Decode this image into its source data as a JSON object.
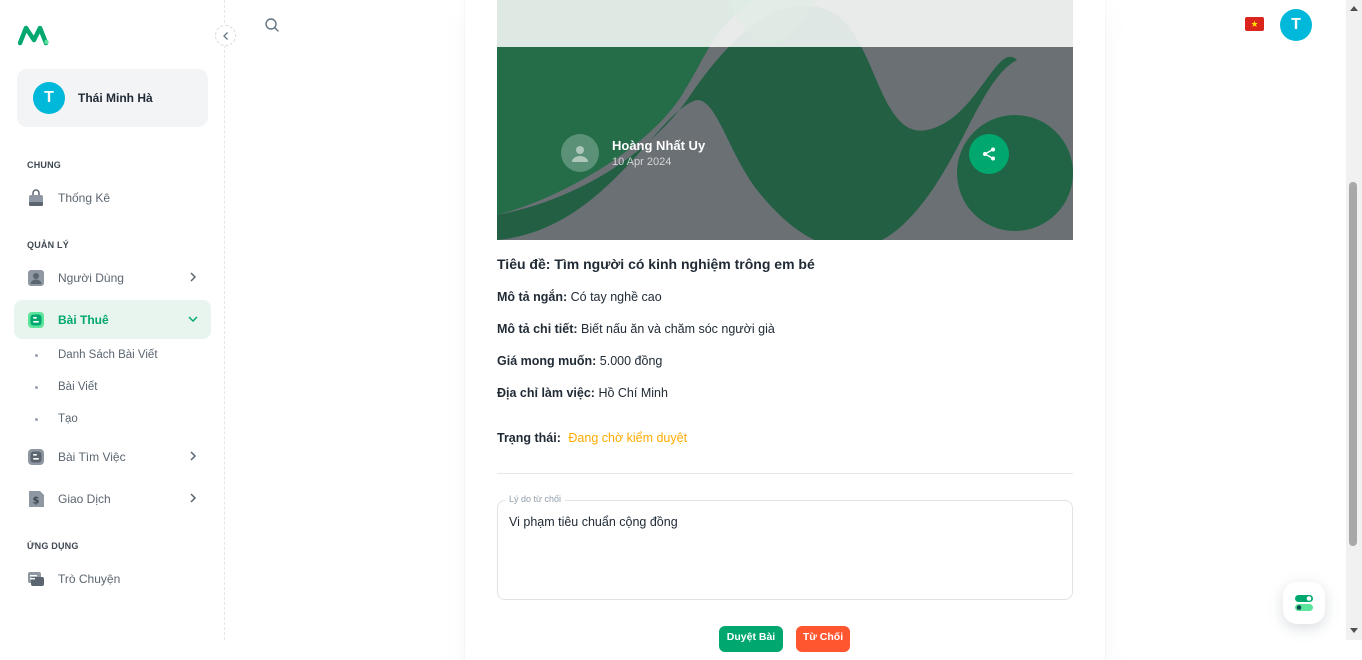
{
  "sidebar": {
    "user_name": "Thái Minh Hà",
    "user_initial": "T",
    "sections": {
      "general": "CHUNG",
      "manage": "QUẢN LÝ",
      "apps": "ỨNG DỤNG"
    },
    "items": {
      "stats": "Thống Kê",
      "users": "Người Dùng",
      "rent_posts": "Bài Thuê",
      "job_posts": "Bài Tìm Việc",
      "transactions": "Giao Dịch",
      "chat": "Trò Chuyện"
    },
    "sub_items": [
      "Danh Sách Bài Viết",
      "Bài Viết",
      "Tạo"
    ]
  },
  "topbar": {
    "avatar_initial": "T",
    "flag_symbol": "★"
  },
  "post": {
    "author_name": "Hoàng Nhất Uy",
    "date": "10 Apr 2024",
    "title_label": "Tiêu đề:",
    "title_value": "Tìm người có kinh nghiệm trông em bé",
    "short_desc_label": "Mô tả ngắn:",
    "short_desc_value": "Có tay nghề cao",
    "detail_desc_label": "Mô tả chi tiết:",
    "detail_desc_value": "Biết nấu ăn và chăm sóc người già",
    "price_label": "Giá mong muốn:",
    "price_value": "5.000 đồng",
    "address_label": "Địa chỉ làm việc:",
    "address_value": "Hồ Chí Minh",
    "status_label": "Trạng thái:",
    "status_value": "Đang chờ kiểm duyệt"
  },
  "reject_form": {
    "label": "Lý do từ chối",
    "value": "Vi phạm tiêu chuẩn cộng đồng"
  },
  "actions": {
    "approve": "Duyệt Bài",
    "reject": "Từ Chối"
  },
  "colors": {
    "primary": "#00a76f",
    "warning": "#ffab00",
    "error": "#ff5630",
    "info": "#00b8d9"
  }
}
